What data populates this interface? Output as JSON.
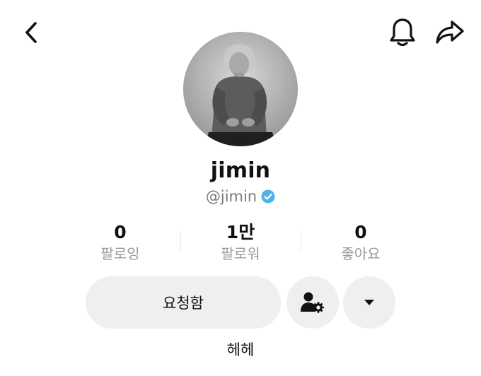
{
  "header": {
    "back_icon": "chevron-left-icon",
    "bell_icon": "bell-icon",
    "share_icon": "share-arrow-icon"
  },
  "profile": {
    "avatar_description": "profile-photo",
    "display_name": "jimin",
    "handle": "@jimin",
    "verified": true,
    "verified_color": "#4fb2e8"
  },
  "stats": [
    {
      "value": "0",
      "label": "팔로잉"
    },
    {
      "value": "1만",
      "label": "팔로워"
    },
    {
      "value": "0",
      "label": "좋아요"
    }
  ],
  "actions": {
    "requested_label": "요청함",
    "manage_icon": "user-settings-icon",
    "more_icon": "caret-down-icon"
  },
  "bio": "헤헤"
}
